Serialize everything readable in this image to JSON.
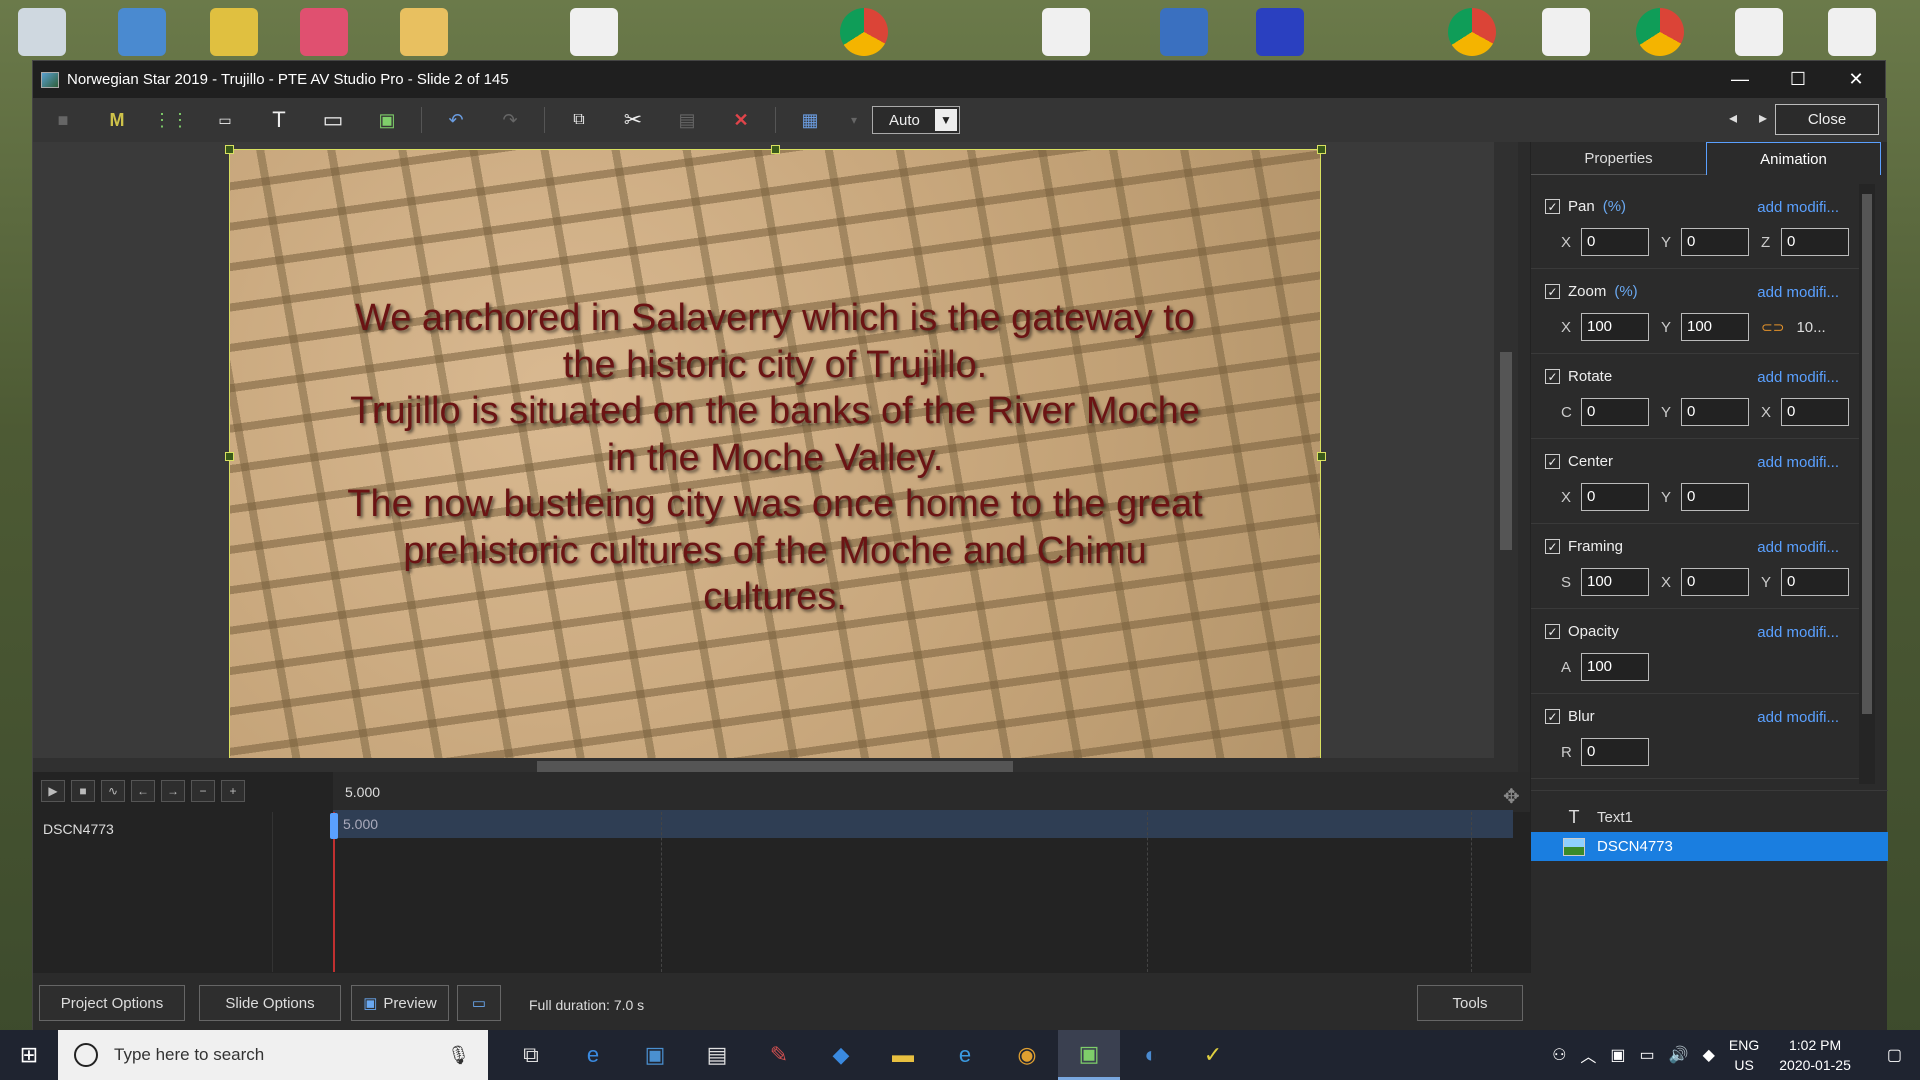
{
  "window": {
    "title": "Norwegian Star 2019 - Trujillo - PTE AV Studio Pro - Slide 2 of 145",
    "minimize": "—",
    "maximize": "☐",
    "close": "✕"
  },
  "toolbar": {
    "zoom_mode": "Auto",
    "close_label": "Close"
  },
  "slide": {
    "text_lines": [
      "We anchored in Salaverry which is the gateway to",
      "the historic city of Trujillo.",
      "Trujillo is situated on the banks of the River Moche",
      "in the Moche Valley.",
      "The now bustleing city was once home to the great",
      "prehistoric cultures of the Moche and Chimu",
      "cultures."
    ]
  },
  "timeline": {
    "ruler_time": "5.000",
    "track_name": "DSCN4773",
    "track_time": "5.000"
  },
  "bottom": {
    "project_options": "Project Options",
    "slide_options": "Slide Options",
    "preview": "Preview",
    "status": "Full duration: 7.0 s",
    "tools": "Tools"
  },
  "panel": {
    "tabs": [
      "Properties",
      "Animation"
    ],
    "add_modifier": "add modifi...",
    "sections": {
      "pan": {
        "label": "Pan",
        "unit": "(%)",
        "fields": [
          {
            "l": "X",
            "v": "0"
          },
          {
            "l": "Y",
            "v": "0"
          },
          {
            "l": "Z",
            "v": "0"
          }
        ]
      },
      "zoom": {
        "label": "Zoom",
        "unit": "(%)",
        "fields": [
          {
            "l": "X",
            "v": "100"
          },
          {
            "l": "Y",
            "v": "100"
          }
        ],
        "extra": "10..."
      },
      "rotate": {
        "label": "Rotate",
        "fields": [
          {
            "l": "C",
            "v": "0"
          },
          {
            "l": "Y",
            "v": "0"
          },
          {
            "l": "X",
            "v": "0"
          }
        ]
      },
      "center": {
        "label": "Center",
        "fields": [
          {
            "l": "X",
            "v": "0"
          },
          {
            "l": "Y",
            "v": "0"
          }
        ]
      },
      "framing": {
        "label": "Framing",
        "fields": [
          {
            "l": "S",
            "v": "100"
          },
          {
            "l": "X",
            "v": "0"
          },
          {
            "l": "Y",
            "v": "0"
          }
        ]
      },
      "opacity": {
        "label": "Opacity",
        "fields": [
          {
            "l": "A",
            "v": "100"
          }
        ]
      },
      "blur": {
        "label": "Blur",
        "fields": [
          {
            "l": "R",
            "v": "0"
          }
        ]
      }
    },
    "objects": [
      {
        "name": "Text1"
      },
      {
        "name": "DSCN4773"
      }
    ]
  },
  "taskbar": {
    "search_placeholder": "Type here to search",
    "lang_top": "ENG",
    "lang_bottom": "US",
    "time": "1:02 PM",
    "date": "2020-01-25"
  }
}
